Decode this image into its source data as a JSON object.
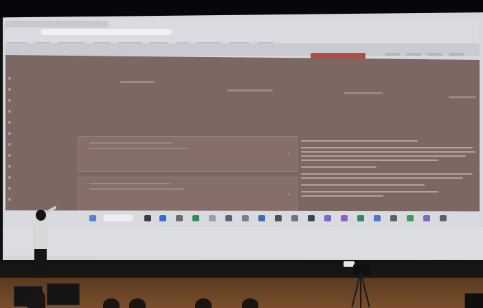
{
  "scene": {
    "description_colors": {
      "screen": "#d6d7db",
      "app_background": "#7b6862",
      "accent_button": "#b24d43",
      "stage_floor": "#7a4e2b"
    }
  },
  "projected_app": {
    "header": {
      "title": "",
      "action_button": ""
    },
    "brand": "",
    "results_heading": "",
    "icons": [
      "search-icon",
      "chevron-right-icon"
    ]
  }
}
